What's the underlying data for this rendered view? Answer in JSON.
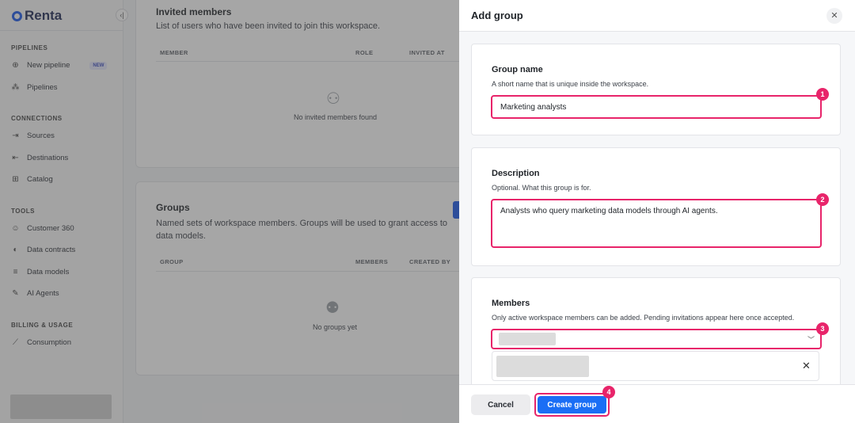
{
  "sidebar": {
    "brand": "Renta",
    "collapse_icon": "‹|",
    "sections": {
      "pipelines": "PIPELINES",
      "connections": "CONNECTIONS",
      "tools": "TOOLS",
      "billing": "BILLING & USAGE"
    },
    "items": {
      "new_pipeline": "New pipeline",
      "new_badge": "NEW",
      "pipelines": "Pipelines",
      "sources": "Sources",
      "destinations": "Destinations",
      "catalog": "Catalog",
      "customer360": "Customer 360",
      "data_contracts": "Data contracts",
      "data_models": "Data models",
      "ai_agents": "AI Agents",
      "consumption": "Consumption"
    }
  },
  "invited": {
    "title": "Invited members",
    "subtitle": "List of users who have been invited to join this workspace.",
    "columns": [
      "MEMBER",
      "ROLE",
      "INVITED AT"
    ],
    "empty": "No invited members found"
  },
  "groups": {
    "title": "Groups",
    "subtitle": "Named sets of workspace members. Groups will be used to grant access to data models.",
    "columns": [
      "GROUP",
      "MEMBERS",
      "CREATED BY"
    ],
    "empty": "No groups yet"
  },
  "modal": {
    "title": "Add group",
    "close_icon": "✕",
    "group_name": {
      "label": "Group name",
      "hint": "A short name that is unique inside the workspace.",
      "value": "Marketing analysts"
    },
    "description": {
      "label": "Description",
      "hint": "Optional. What this group is for.",
      "value": "Analysts who query marketing data models through AI agents."
    },
    "members": {
      "label": "Members",
      "hint": "Only active workspace members can be added. Pending invitations appear here once accepted.",
      "remove_icon": "✕"
    },
    "cancel_label": "Cancel",
    "create_label": "Create group",
    "markers": [
      "1",
      "2",
      "3",
      "4"
    ],
    "accent": "#e8246a",
    "primary": "#1a6ef5"
  }
}
